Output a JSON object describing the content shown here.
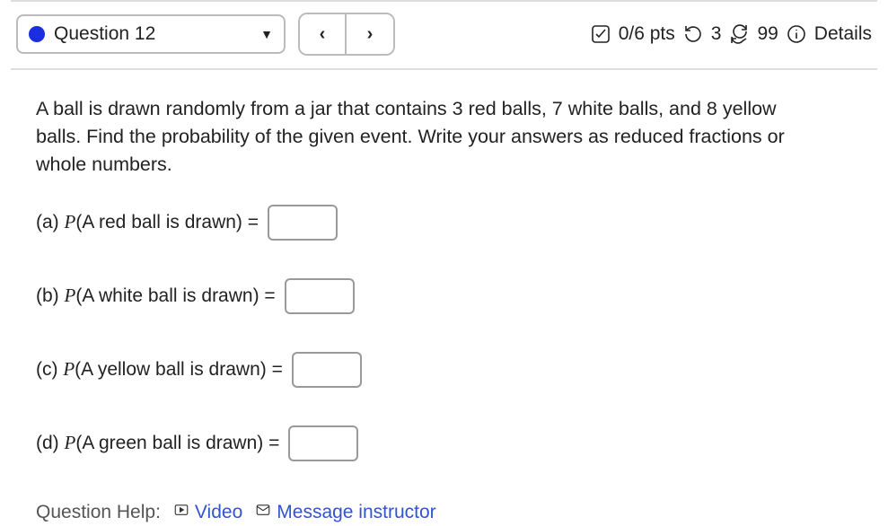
{
  "header": {
    "question_label": "Question 12",
    "prev": "‹",
    "next": "›",
    "score": "0/6 pts",
    "attempts_used": "3",
    "attempts_total": "99",
    "details": "Details"
  },
  "prompt": "A ball is drawn randomly from a jar that contains 3 red balls, 7 white balls, and 8 yellow balls. Find the probability of the given event. Write your answers as reduced fractions or whole numbers.",
  "parts": [
    {
      "prefix": "(a) ",
      "p": "P",
      "mid": "(A red ball is drawn) ="
    },
    {
      "prefix": "(b) ",
      "p": "P",
      "mid": "(A white ball is drawn) ="
    },
    {
      "prefix": "(c) ",
      "p": "P",
      "mid": "(A yellow ball is drawn) ="
    },
    {
      "prefix": "(d) ",
      "p": "P",
      "mid": "(A green ball is drawn) ="
    }
  ],
  "help": {
    "label": "Question Help:",
    "video": "Video",
    "message": "Message instructor"
  }
}
